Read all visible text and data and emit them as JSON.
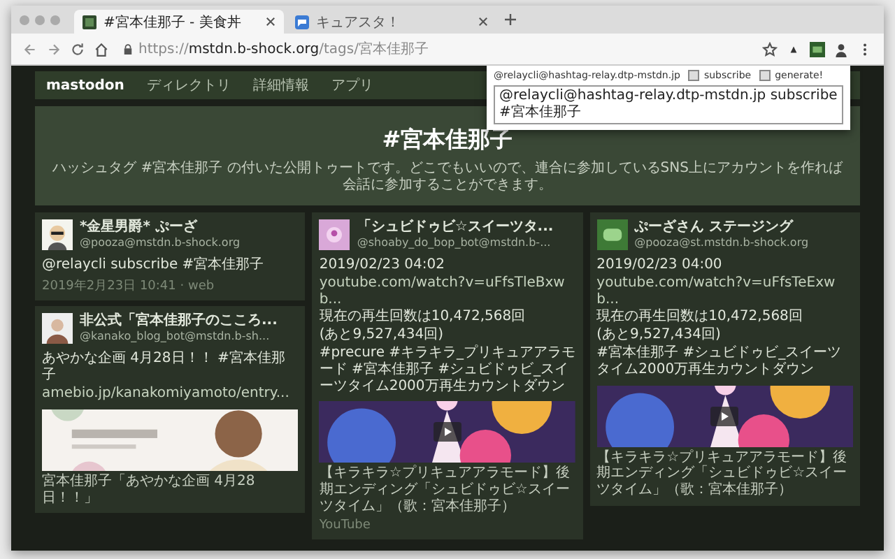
{
  "tabs": [
    {
      "title": "#宮本佳那子 - 美食丼",
      "selected": true,
      "kind": "mastodon"
    },
    {
      "title": "キュアスタ！",
      "selected": false,
      "kind": "chat"
    }
  ],
  "address": {
    "scheme": "https://",
    "host": "mstdn.b-shock.org",
    "path": "/tags/宮本佳那子"
  },
  "popup": {
    "account": "@relaycli@hashtag-relay.dtp-mstdn.jp",
    "buttons": [
      "subscribe",
      "generate!"
    ],
    "command": "@relaycli@hashtag-relay.dtp-mstdn.jp subscribe #宮本佳那子"
  },
  "nav": {
    "brand": "mastodon",
    "items": [
      "ディレクトリ",
      "詳細情報",
      "アプリ"
    ]
  },
  "hero": {
    "title": "#宮本佳那子",
    "description": "ハッシュタグ #宮本佳那子 の付いた公開トゥートです。どこでもいいので、連合に参加しているSNS上にアカウントを作れば会話に参加することができます。"
  },
  "columns": [
    [
      {
        "avatar": {
          "kind": "glasses"
        },
        "name": "*金星男爵* ぷーざ",
        "handle": "@pooza@mstdn.b-shock.org",
        "lines": [
          {
            "kind": "text",
            "text": "@relaycli subscribe #宮本佳那子"
          }
        ],
        "meta": "2019年2月23日 10:41 · web"
      },
      {
        "avatar": {
          "kind": "figure"
        },
        "name": "非公式「宮本佳那子のこころ...",
        "handle": "@kanako_blog_bot@mstdn.b-sh...",
        "lines": [
          {
            "kind": "text",
            "text": "あやかな企画 4月28日！！ #宮本佳那子"
          },
          {
            "kind": "link",
            "text": "amebio.jp/kanakomiyamoto/entry..."
          }
        ],
        "media": {
          "kind": "picture",
          "caption": "宮本佳那子「あやかな企画 4月28日！！」"
        }
      }
    ],
    [
      {
        "avatar": {
          "kind": "sweets"
        },
        "name": "「シュビドゥビ☆スイーツタ...",
        "handle": "@shoaby_do_bop_bot@mstdn.b-...",
        "lines": [
          {
            "kind": "text",
            "text": "2019/02/23 04:02"
          },
          {
            "kind": "link",
            "text": "youtube.com/watch?v=uFfsTleBxwb..."
          },
          {
            "kind": "text",
            "text": "現在の再生回数は10,472,568回"
          },
          {
            "kind": "text",
            "text": "(あと9,527,434回)"
          },
          {
            "kind": "text",
            "text": "#precure #キラキラ_プリキュアアラモード #宮本佳那子 #シュビドゥビ_スイーツタイム2000万再生カウントダウン"
          }
        ],
        "media": {
          "kind": "video",
          "caption": "【キラキラ☆プリキュアアラモード】後期エンディング「シュビドゥビ☆スイーツタイム」（歌：宮本佳那子）",
          "source": "YouTube"
        }
      }
    ],
    [
      {
        "avatar": {
          "kind": "logo"
        },
        "name": "ぷーざさん ステージング",
        "handle": "@pooza@st.mstdn.b-shock.org",
        "lines": [
          {
            "kind": "text",
            "text": "2019/02/23 04:00"
          },
          {
            "kind": "link",
            "text": "youtube.com/watch?v=uFfsTeExwb..."
          },
          {
            "kind": "text",
            "text": "現在の再生回数は10,472,568回"
          },
          {
            "kind": "text",
            "text": "(あと9,527,434回)"
          },
          {
            "kind": "text",
            "text": "#宮本佳那子 #シュビドゥビ_スイーツタイム2000万再生カウントダウン"
          }
        ],
        "media": {
          "kind": "video",
          "caption": "【キラキラ☆プリキュアアラモード】後期エンディング「シュビドゥビ☆スイーツタイム」（歌：宮本佳那子）"
        }
      }
    ]
  ]
}
